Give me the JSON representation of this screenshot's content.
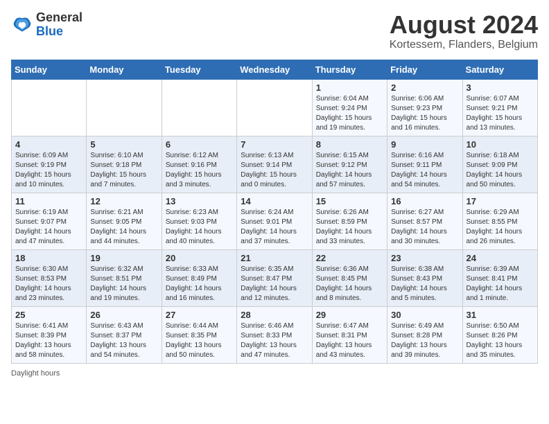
{
  "header": {
    "logo": {
      "general": "General",
      "blue": "Blue"
    },
    "title": "August 2024",
    "subtitle": "Kortessem, Flanders, Belgium"
  },
  "days_of_week": [
    "Sunday",
    "Monday",
    "Tuesday",
    "Wednesday",
    "Thursday",
    "Friday",
    "Saturday"
  ],
  "weeks": [
    [
      {
        "day": "",
        "info": ""
      },
      {
        "day": "",
        "info": ""
      },
      {
        "day": "",
        "info": ""
      },
      {
        "day": "",
        "info": ""
      },
      {
        "day": "1",
        "info": "Sunrise: 6:04 AM\nSunset: 9:24 PM\nDaylight: 15 hours\nand 19 minutes."
      },
      {
        "day": "2",
        "info": "Sunrise: 6:06 AM\nSunset: 9:23 PM\nDaylight: 15 hours\nand 16 minutes."
      },
      {
        "day": "3",
        "info": "Sunrise: 6:07 AM\nSunset: 9:21 PM\nDaylight: 15 hours\nand 13 minutes."
      }
    ],
    [
      {
        "day": "4",
        "info": "Sunrise: 6:09 AM\nSunset: 9:19 PM\nDaylight: 15 hours\nand 10 minutes."
      },
      {
        "day": "5",
        "info": "Sunrise: 6:10 AM\nSunset: 9:18 PM\nDaylight: 15 hours\nand 7 minutes."
      },
      {
        "day": "6",
        "info": "Sunrise: 6:12 AM\nSunset: 9:16 PM\nDaylight: 15 hours\nand 3 minutes."
      },
      {
        "day": "7",
        "info": "Sunrise: 6:13 AM\nSunset: 9:14 PM\nDaylight: 15 hours\nand 0 minutes."
      },
      {
        "day": "8",
        "info": "Sunrise: 6:15 AM\nSunset: 9:12 PM\nDaylight: 14 hours\nand 57 minutes."
      },
      {
        "day": "9",
        "info": "Sunrise: 6:16 AM\nSunset: 9:11 PM\nDaylight: 14 hours\nand 54 minutes."
      },
      {
        "day": "10",
        "info": "Sunrise: 6:18 AM\nSunset: 9:09 PM\nDaylight: 14 hours\nand 50 minutes."
      }
    ],
    [
      {
        "day": "11",
        "info": "Sunrise: 6:19 AM\nSunset: 9:07 PM\nDaylight: 14 hours\nand 47 minutes."
      },
      {
        "day": "12",
        "info": "Sunrise: 6:21 AM\nSunset: 9:05 PM\nDaylight: 14 hours\nand 44 minutes."
      },
      {
        "day": "13",
        "info": "Sunrise: 6:23 AM\nSunset: 9:03 PM\nDaylight: 14 hours\nand 40 minutes."
      },
      {
        "day": "14",
        "info": "Sunrise: 6:24 AM\nSunset: 9:01 PM\nDaylight: 14 hours\nand 37 minutes."
      },
      {
        "day": "15",
        "info": "Sunrise: 6:26 AM\nSunset: 8:59 PM\nDaylight: 14 hours\nand 33 minutes."
      },
      {
        "day": "16",
        "info": "Sunrise: 6:27 AM\nSunset: 8:57 PM\nDaylight: 14 hours\nand 30 minutes."
      },
      {
        "day": "17",
        "info": "Sunrise: 6:29 AM\nSunset: 8:55 PM\nDaylight: 14 hours\nand 26 minutes."
      }
    ],
    [
      {
        "day": "18",
        "info": "Sunrise: 6:30 AM\nSunset: 8:53 PM\nDaylight: 14 hours\nand 23 minutes."
      },
      {
        "day": "19",
        "info": "Sunrise: 6:32 AM\nSunset: 8:51 PM\nDaylight: 14 hours\nand 19 minutes."
      },
      {
        "day": "20",
        "info": "Sunrise: 6:33 AM\nSunset: 8:49 PM\nDaylight: 14 hours\nand 16 minutes."
      },
      {
        "day": "21",
        "info": "Sunrise: 6:35 AM\nSunset: 8:47 PM\nDaylight: 14 hours\nand 12 minutes."
      },
      {
        "day": "22",
        "info": "Sunrise: 6:36 AM\nSunset: 8:45 PM\nDaylight: 14 hours\nand 8 minutes."
      },
      {
        "day": "23",
        "info": "Sunrise: 6:38 AM\nSunset: 8:43 PM\nDaylight: 14 hours\nand 5 minutes."
      },
      {
        "day": "24",
        "info": "Sunrise: 6:39 AM\nSunset: 8:41 PM\nDaylight: 14 hours\nand 1 minute."
      }
    ],
    [
      {
        "day": "25",
        "info": "Sunrise: 6:41 AM\nSunset: 8:39 PM\nDaylight: 13 hours\nand 58 minutes."
      },
      {
        "day": "26",
        "info": "Sunrise: 6:43 AM\nSunset: 8:37 PM\nDaylight: 13 hours\nand 54 minutes."
      },
      {
        "day": "27",
        "info": "Sunrise: 6:44 AM\nSunset: 8:35 PM\nDaylight: 13 hours\nand 50 minutes."
      },
      {
        "day": "28",
        "info": "Sunrise: 6:46 AM\nSunset: 8:33 PM\nDaylight: 13 hours\nand 47 minutes."
      },
      {
        "day": "29",
        "info": "Sunrise: 6:47 AM\nSunset: 8:31 PM\nDaylight: 13 hours\nand 43 minutes."
      },
      {
        "day": "30",
        "info": "Sunrise: 6:49 AM\nSunset: 8:28 PM\nDaylight: 13 hours\nand 39 minutes."
      },
      {
        "day": "31",
        "info": "Sunrise: 6:50 AM\nSunset: 8:26 PM\nDaylight: 13 hours\nand 35 minutes."
      }
    ]
  ],
  "footer": {
    "daylight_label": "Daylight hours"
  }
}
